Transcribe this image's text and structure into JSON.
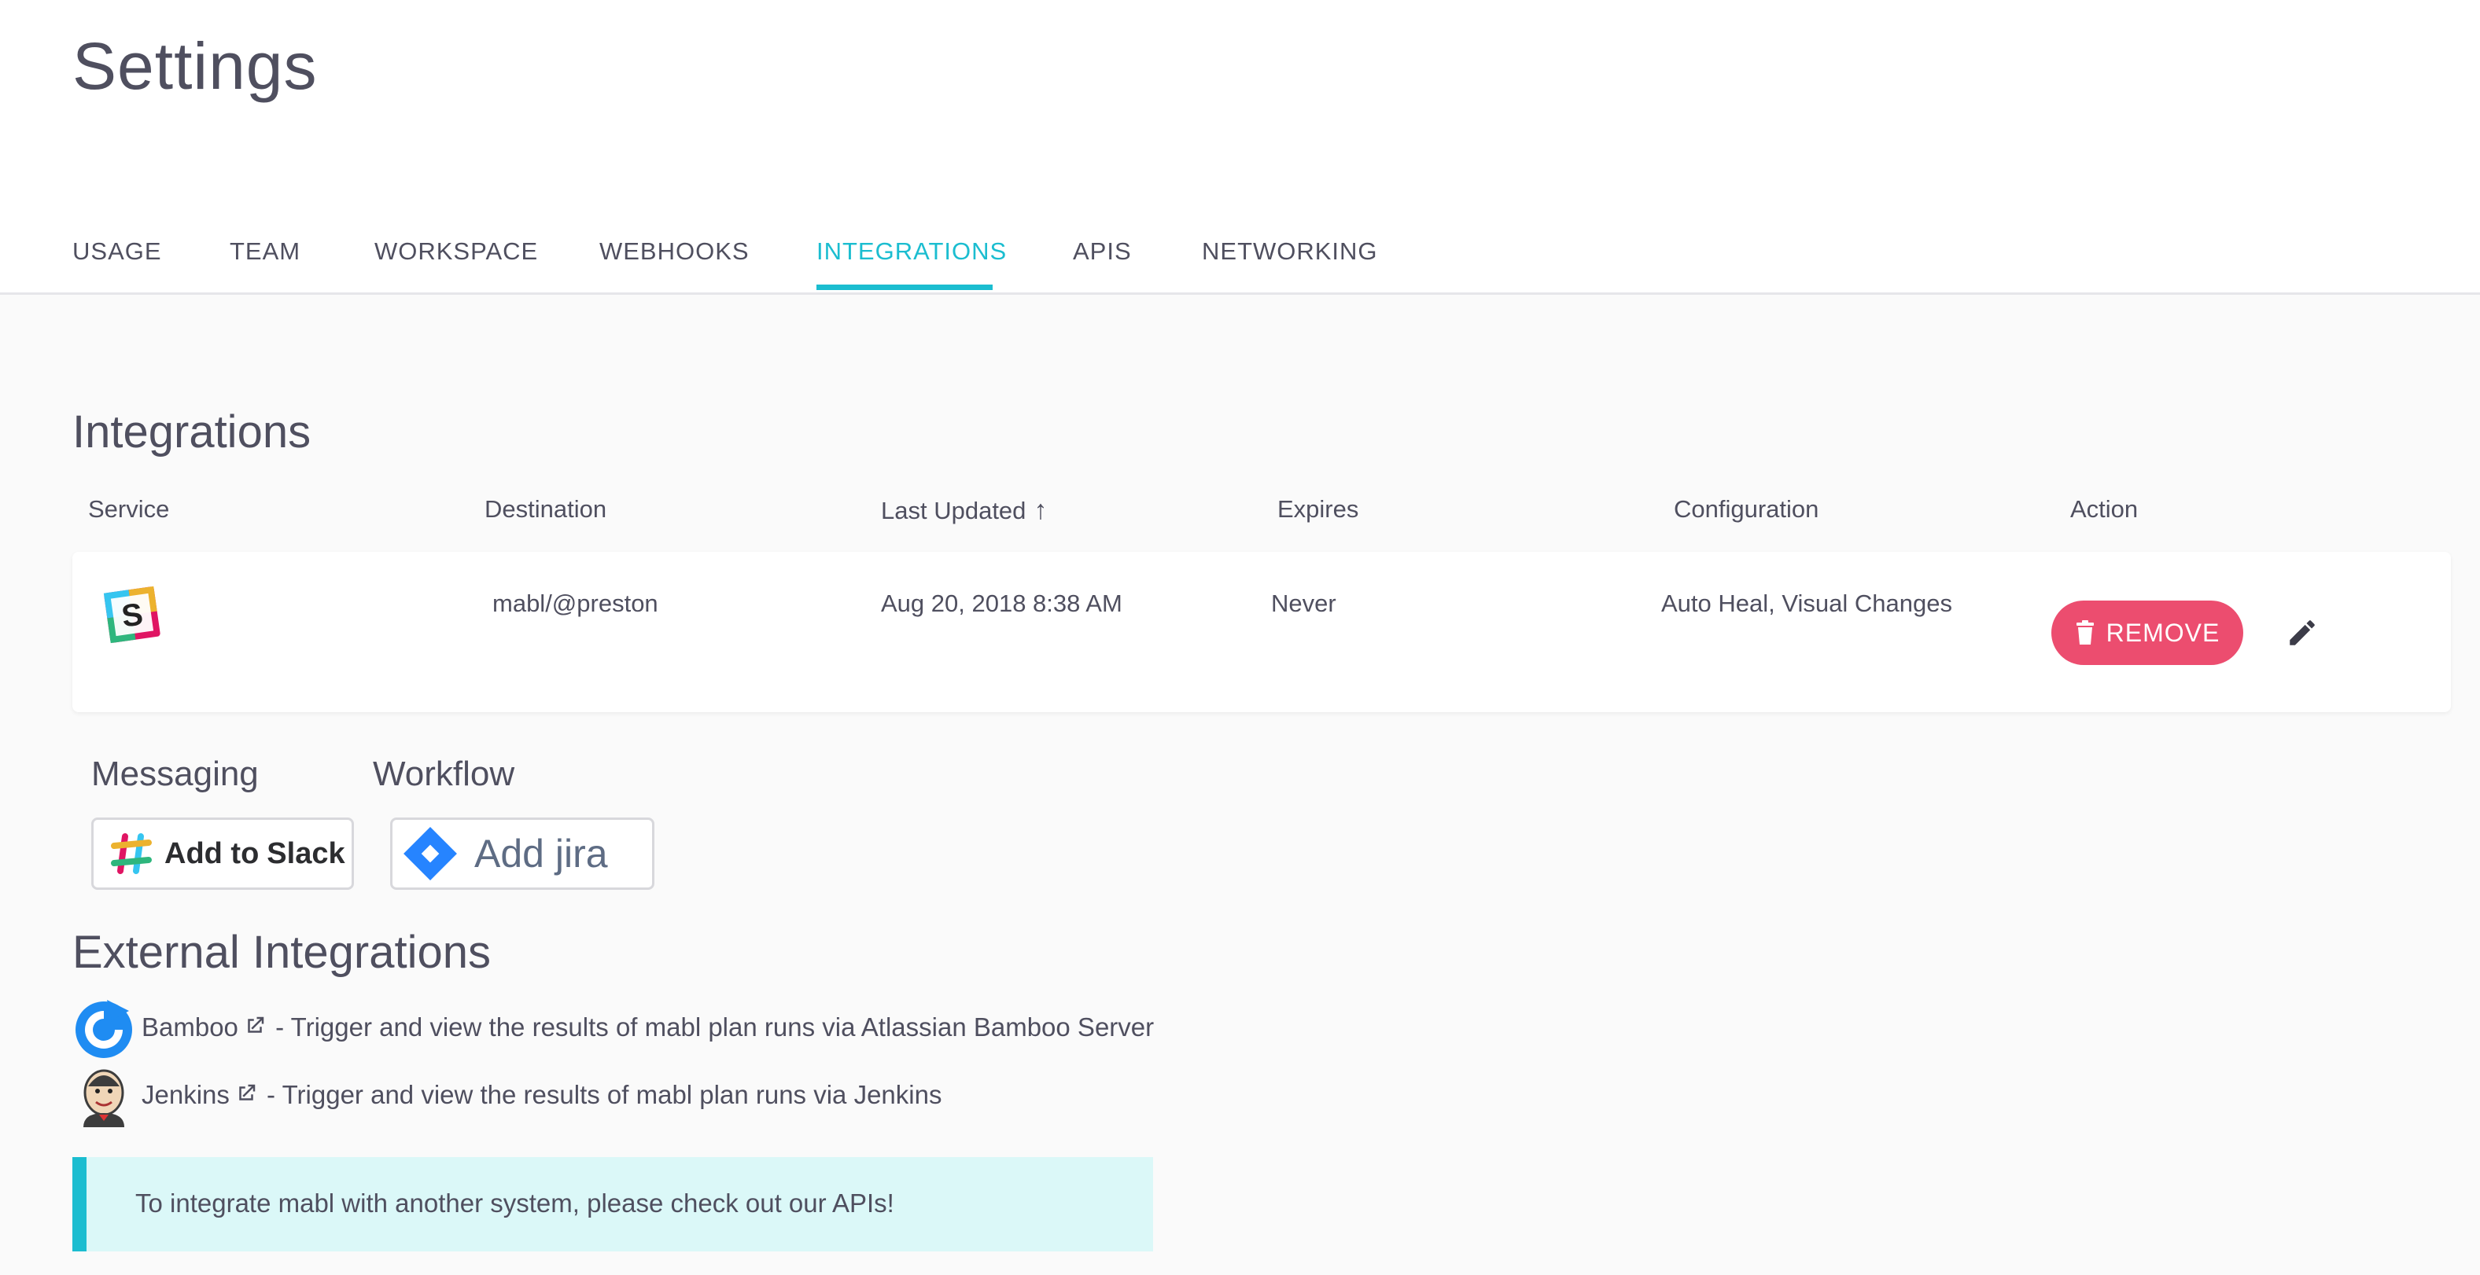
{
  "page": {
    "title": "Settings"
  },
  "tabs": [
    {
      "label": "USAGE"
    },
    {
      "label": "TEAM"
    },
    {
      "label": "WORKSPACE"
    },
    {
      "label": "WEBHOOKS"
    },
    {
      "label": "INTEGRATIONS",
      "active": true
    },
    {
      "label": "APIS"
    },
    {
      "label": "NETWORKING"
    }
  ],
  "integrations": {
    "title": "Integrations",
    "columns": [
      "Service",
      "Destination",
      "Last Updated",
      "Expires",
      "Configuration",
      "Action"
    ],
    "sort_indicator": "↑",
    "rows": [
      {
        "service_icon": "slack-icon",
        "destination": "mabl/@preston",
        "last_updated": "Aug 20, 2018 8:38 AM",
        "expires": "Never",
        "configuration": "Auto Heal, Visual Changes",
        "remove_label": "REMOVE"
      }
    ]
  },
  "add_integrations": {
    "messaging_label": "Messaging",
    "workflow_label": "Workflow",
    "slack_button": {
      "text_a": "Add to",
      "text_b": "Slack"
    },
    "jira_button": {
      "text": "Add jira"
    }
  },
  "external": {
    "title": "External Integrations",
    "items": [
      {
        "name": "Bamboo",
        "description": " - Trigger and view the results of mabl plan runs via Atlassian Bamboo Server",
        "icon": "bamboo-icon"
      },
      {
        "name": "Jenkins",
        "description": " - Trigger and view the results of mabl plan runs via Jenkins",
        "icon": "jenkins-icon"
      }
    ]
  },
  "callout": {
    "text": "To integrate mabl with another system, please check out our APIs!"
  },
  "colors": {
    "accent": "#1bbdd0",
    "remove": "#ec4d6f",
    "callout_bg": "#dbf8f8"
  }
}
